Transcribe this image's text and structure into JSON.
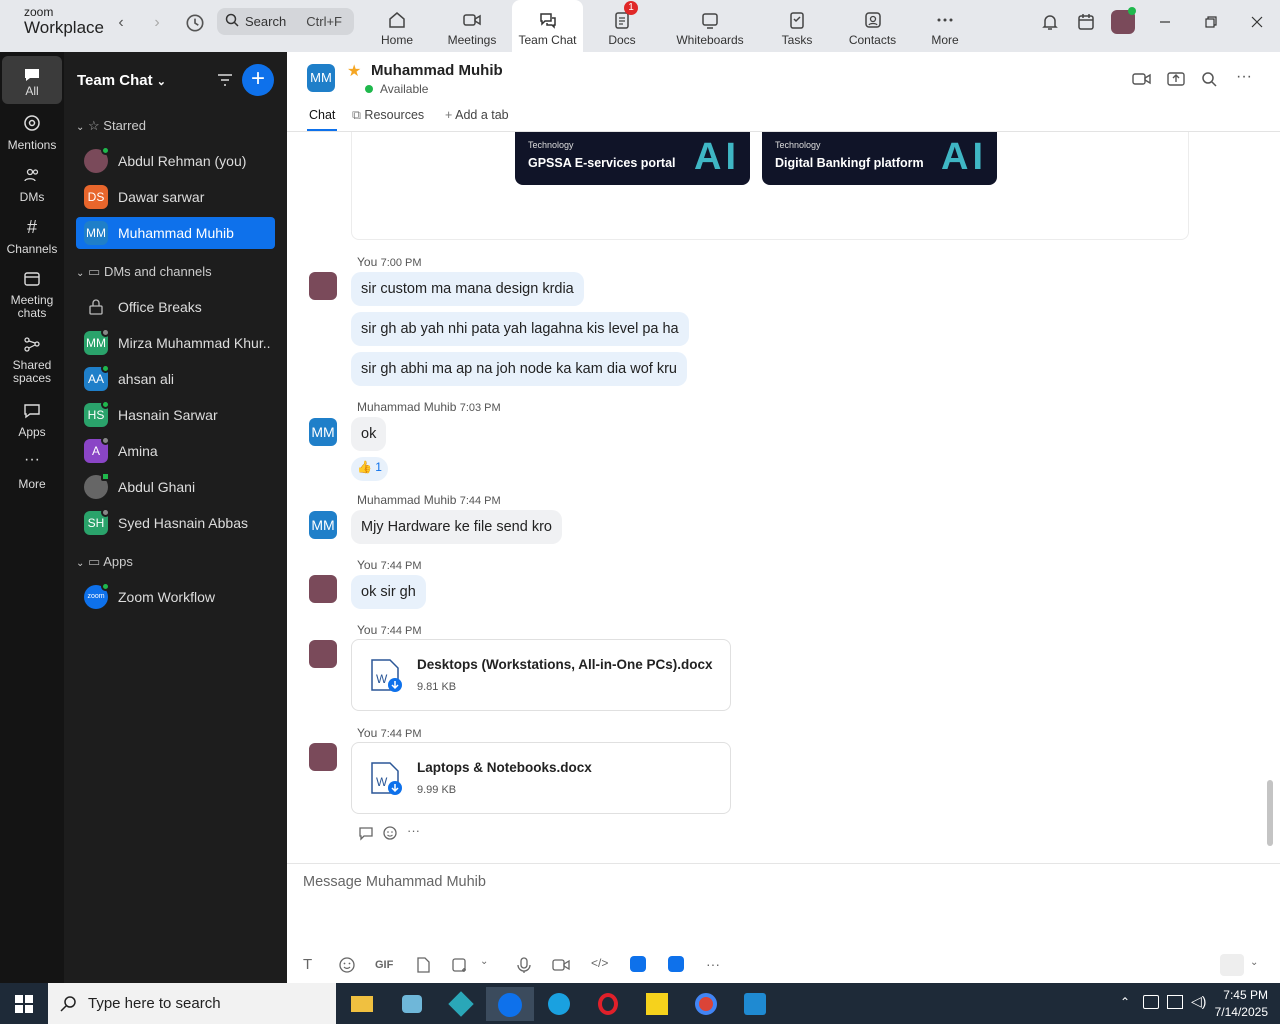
{
  "topbar": {
    "logo_small": "zoom",
    "logo_big": "Workplace",
    "search_label": "Search",
    "search_shortcut": "Ctrl+F",
    "tabs": [
      {
        "label": "Home"
      },
      {
        "label": "Meetings"
      },
      {
        "label": "Team Chat"
      },
      {
        "label": "Docs",
        "badge": "1"
      },
      {
        "label": "Whiteboards"
      },
      {
        "label": "Tasks"
      },
      {
        "label": "Contacts"
      },
      {
        "label": "More"
      }
    ]
  },
  "rail": {
    "items": [
      {
        "label": "All"
      },
      {
        "label": "Mentions"
      },
      {
        "label": "DMs"
      },
      {
        "label": "Channels"
      },
      {
        "label": "Meeting chats"
      },
      {
        "label": "Shared spaces"
      },
      {
        "label": "Apps"
      },
      {
        "label": "More"
      }
    ]
  },
  "sidebar": {
    "title": "Team Chat",
    "starred_label": "Starred",
    "dms_label": "DMs and channels",
    "apps_label": "Apps",
    "starred": [
      {
        "name": "Abdul Rehman (you)",
        "initials": "",
        "color": "#7a4a5a"
      },
      {
        "name": "Dawar sarwar",
        "initials": "DS",
        "color": "#e8662c"
      },
      {
        "name": "Muhammad Muhib",
        "initials": "MM",
        "color": "#1f7fc9"
      }
    ],
    "dms": [
      {
        "name": "Office Breaks",
        "initials": "",
        "color": ""
      },
      {
        "name": "Mirza Muhammad Khur...",
        "initials": "MM",
        "color": "#2aa36b"
      },
      {
        "name": "ahsan ali",
        "initials": "AA",
        "color": "#1f7fc9"
      },
      {
        "name": "Hasnain Sarwar",
        "initials": "HS",
        "color": "#2aa36b"
      },
      {
        "name": "Amina",
        "initials": "A",
        "color": "#8a45c6"
      },
      {
        "name": "Abdul Ghani",
        "initials": "",
        "color": "#666"
      },
      {
        "name": "Syed Hasnain Abbas",
        "initials": "SH",
        "color": "#2aa36b"
      }
    ],
    "apps": [
      {
        "name": "Zoom Workflow",
        "initials": "zoom",
        "color": "#0e71eb"
      }
    ]
  },
  "chat": {
    "contact_initials": "MM",
    "contact_name": "Muhammad Muhib",
    "contact_status": "Available",
    "tabs": {
      "chat": "Chat",
      "resources": "Resources",
      "add": "Add a tab"
    },
    "image_cards": [
      {
        "category": "Technology",
        "title": "GPSSA E-services portal",
        "badge": "AI"
      },
      {
        "category": "Technology",
        "title": "Digital Bankingf platform",
        "badge": "AI"
      }
    ],
    "groups": [
      {
        "sender": "You",
        "time": "7:00 PM",
        "messages": [
          "sir custom ma mana design krdia",
          "sir gh ab yah nhi pata yah lagahna kis level pa ha",
          "sir gh abhi ma ap na joh node ka kam dia wof kru"
        ]
      },
      {
        "sender": "Muhammad Muhib",
        "time": "7:03 PM",
        "messages": [
          "ok"
        ],
        "reaction": "👍",
        "reaction_count": "1"
      },
      {
        "sender": "Muhammad Muhib",
        "time": "7:44 PM",
        "messages": [
          "Mjy Hardware ke file send kro"
        ]
      },
      {
        "sender": "You",
        "time": "7:44 PM",
        "messages": [
          "ok sir gh"
        ]
      }
    ],
    "files": [
      {
        "sender": "You",
        "time": "7:44 PM",
        "name": "Desktops (Workstations, All-in-One PCs).docx",
        "size": "9.81 KB"
      },
      {
        "sender": "You",
        "time": "7:44 PM",
        "name": "Laptops & Notebooks.docx",
        "size": "9.99 KB"
      }
    ],
    "composer_placeholder": "Message Muhammad Muhib",
    "gif_label": "GIF"
  },
  "taskbar": {
    "search_placeholder": "Type here to search",
    "time": "7:45 PM",
    "date": "7/14/2025"
  }
}
